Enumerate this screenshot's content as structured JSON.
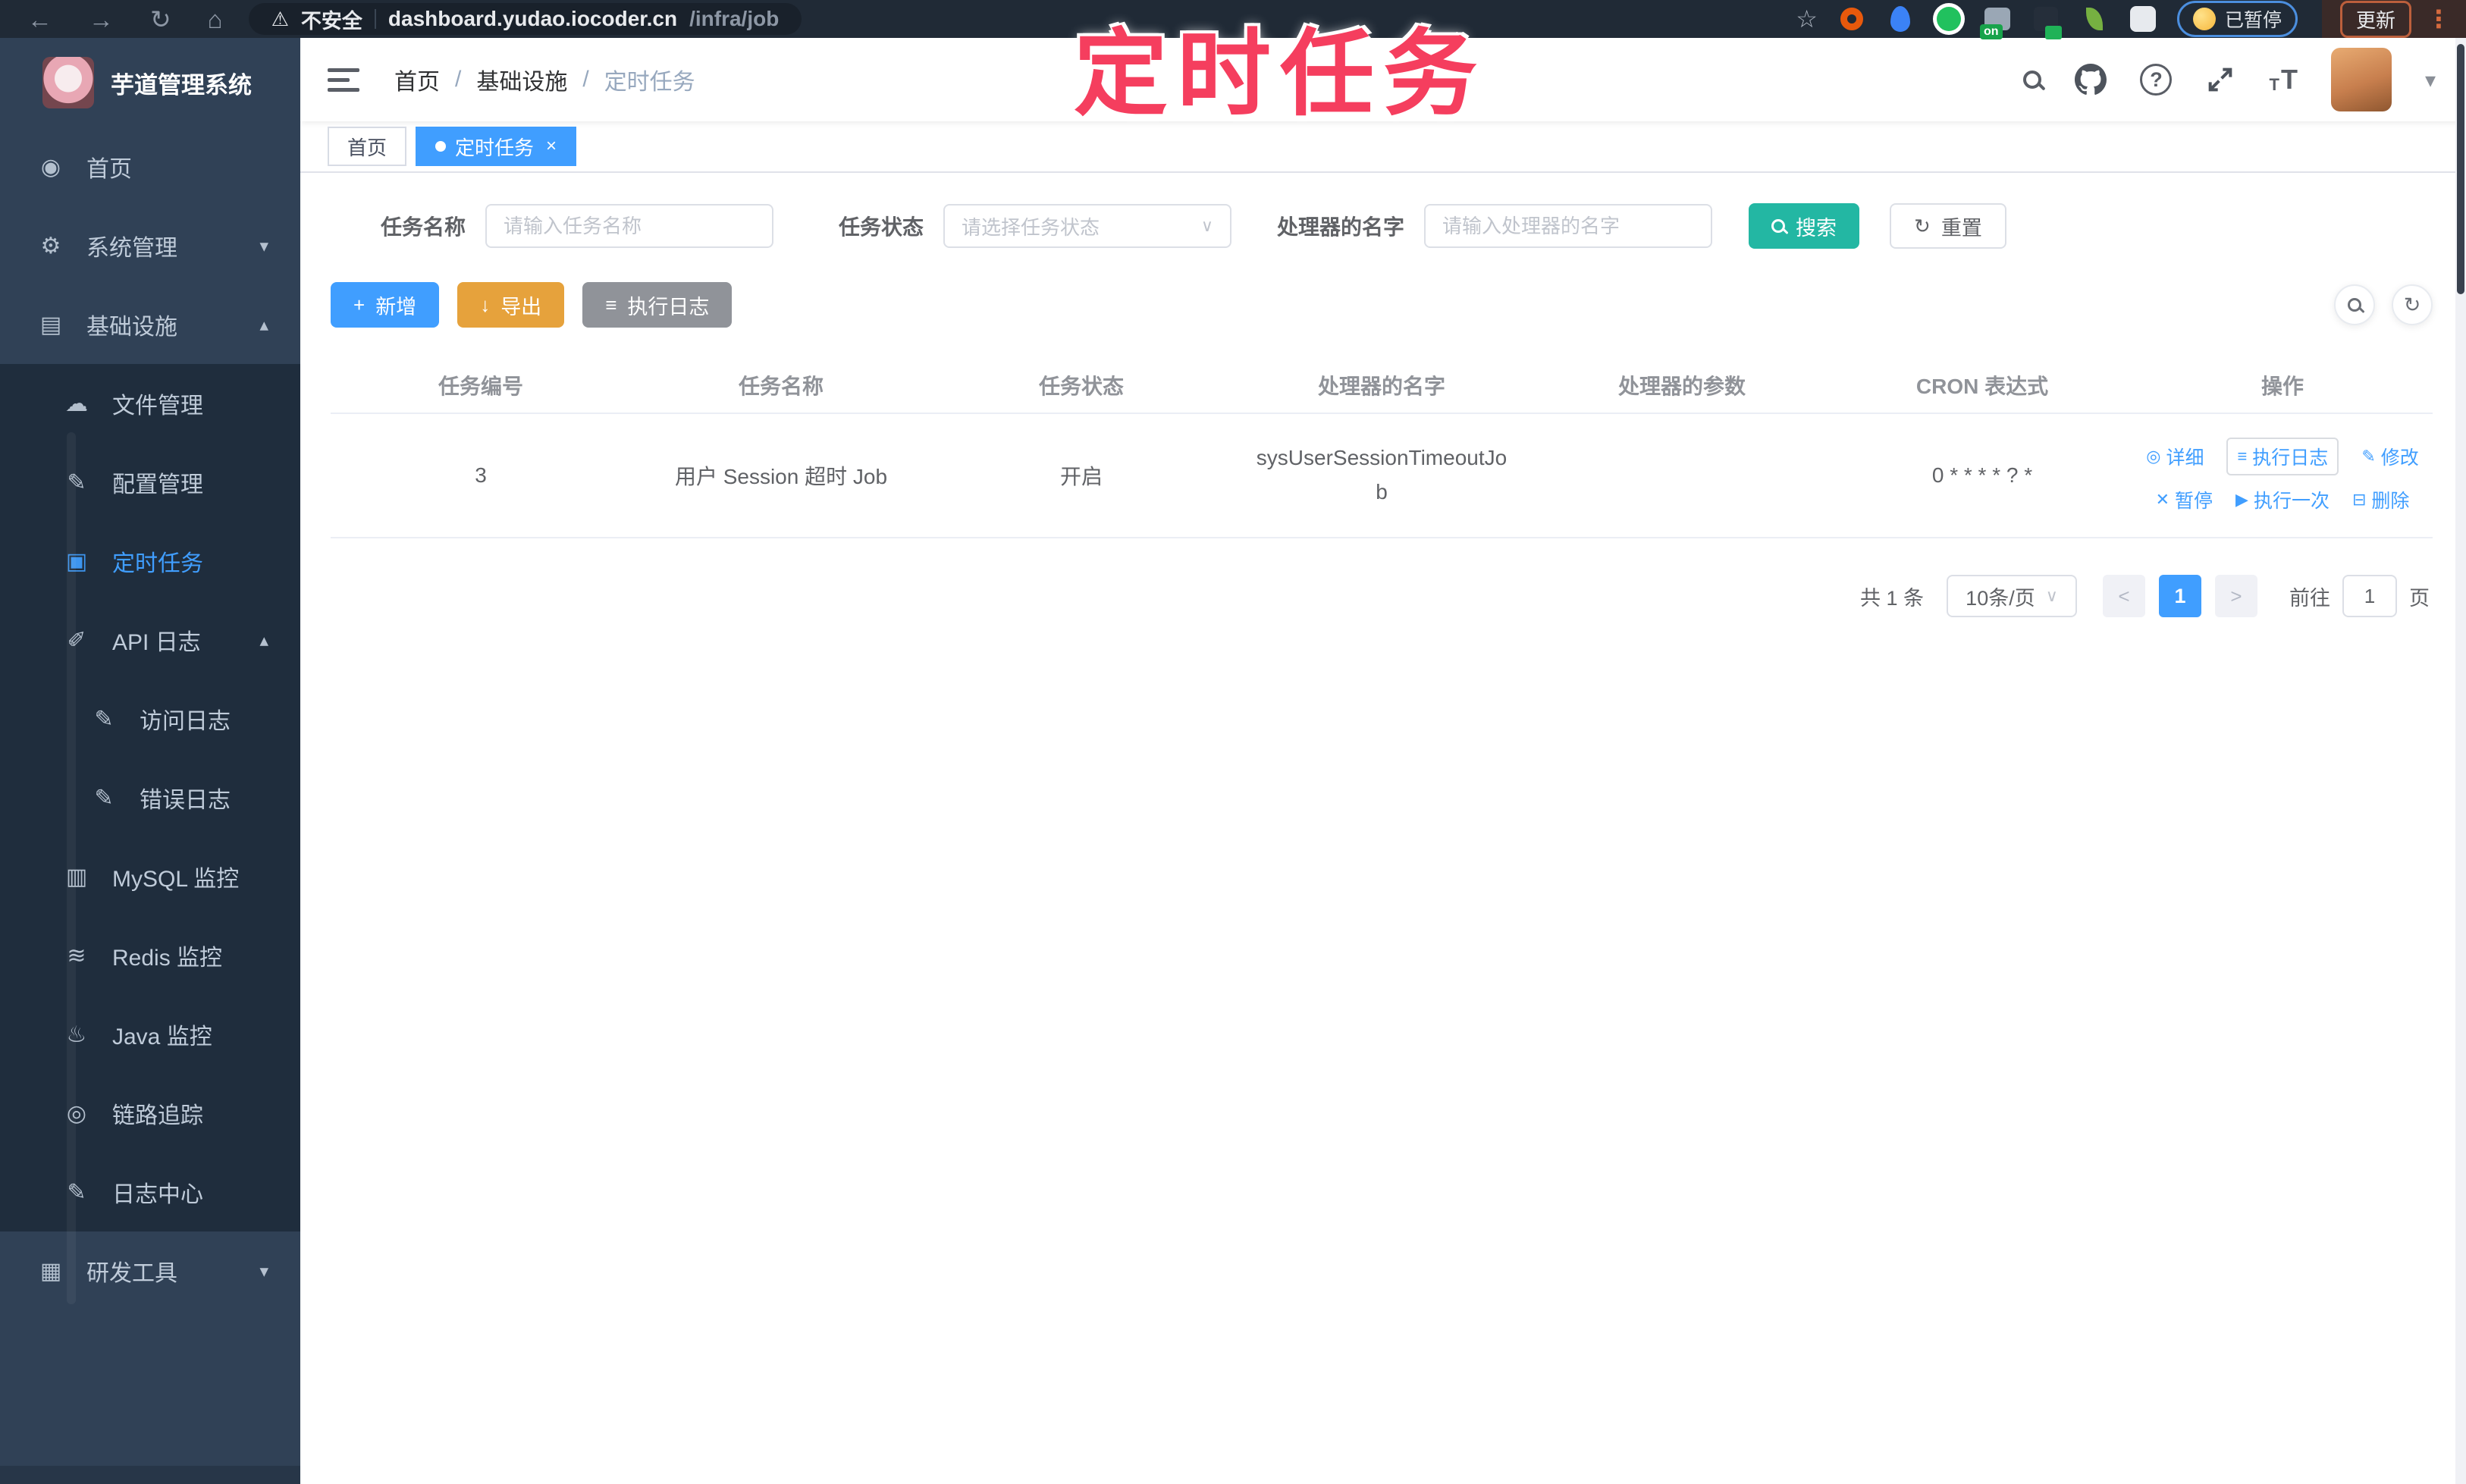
{
  "colors": {
    "primary": "#409EFF",
    "search_button": "#23b7a3",
    "export_button": "#E6A23C",
    "info_button": "#909399",
    "annotation_red": "#f53e5e",
    "sidebar_bg": "#304156",
    "submenu_bg": "#1f2d3d",
    "sidebar_text": "#bfcbd9",
    "browser_bar_bg": "#202a36"
  },
  "browser": {
    "security_label": "不安全",
    "url_host": "dashboard.yudao.iocoder.cn",
    "url_path": "/infra/job",
    "ext_badge": "on",
    "paused_label": "已暂停",
    "update_label": "更新"
  },
  "icons": {
    "back": "←",
    "forward": "→",
    "reload": "↻",
    "home": "⌂",
    "warning": "⚠",
    "star": "☆",
    "question": "?",
    "caret_down": "▾",
    "dots": "⋮",
    "t_big": "T",
    "t_small": "T",
    "select_caret": "∨",
    "refresh": "↻",
    "close": "×",
    "prev": "<",
    "next": ">",
    "download": "↓",
    "plus": "+",
    "list": "≡"
  },
  "sidebar": {
    "title": "芋道管理系统",
    "items": [
      {
        "label": "首页",
        "icon": "◉"
      },
      {
        "label": "系统管理",
        "icon": "⚙",
        "arrow": "▾"
      },
      {
        "label": "基础设施",
        "icon": "▤",
        "arrow": "▴"
      },
      {
        "label": "文件管理",
        "icon": "☁"
      },
      {
        "label": "配置管理",
        "icon": "✎"
      },
      {
        "label": "定时任务",
        "icon": "▣"
      },
      {
        "label": "API 日志",
        "icon": "✐",
        "arrow": "▴"
      },
      {
        "label": "访问日志",
        "icon": "✎"
      },
      {
        "label": "错误日志",
        "icon": "✎"
      },
      {
        "label": "MySQL 监控",
        "icon": "▥"
      },
      {
        "label": "Redis 监控",
        "icon": "≋"
      },
      {
        "label": "Java 监控",
        "icon": "♨"
      },
      {
        "label": "链路追踪",
        "icon": "◎"
      },
      {
        "label": "日志中心",
        "icon": "✎"
      },
      {
        "label": "研发工具",
        "icon": "▦",
        "arrow": "▾"
      }
    ]
  },
  "header": {
    "breadcrumb": [
      "首页",
      "基础设施",
      "定时任务"
    ],
    "separator": "/"
  },
  "annotation": "定时任务",
  "tabs": [
    {
      "label": "首页"
    },
    {
      "label": "定时任务"
    }
  ],
  "filters": {
    "name_label": "任务名称",
    "name_placeholder": "请输入任务名称",
    "status_label": "任务状态",
    "status_placeholder": "请选择任务状态",
    "handler_label": "处理器的名字",
    "handler_placeholder": "请输入处理器的名字",
    "search_label": "搜索",
    "reset_label": "重置"
  },
  "toolbar": {
    "add": "新增",
    "export": "导出",
    "exec_log": "执行日志"
  },
  "table": {
    "headers": [
      "任务编号",
      "任务名称",
      "任务状态",
      "处理器的名字",
      "处理器的参数",
      "CRON 表达式",
      "操作"
    ],
    "row": {
      "id": "3",
      "name": "用户 Session 超时 Job",
      "status": "开启",
      "handler": "sysUserSessionTimeoutJob",
      "params": "",
      "cron": "0 * * * * ? *"
    },
    "actions": [
      {
        "icon": "◎",
        "label": "详细"
      },
      {
        "icon": "≡",
        "label": "执行日志"
      },
      {
        "icon": "✎",
        "label": "修改"
      },
      {
        "icon": "✕",
        "label": "暂停"
      },
      {
        "icon": "▶",
        "label": "执行一次"
      },
      {
        "icon": "⊟",
        "label": "删除"
      }
    ]
  },
  "pagination": {
    "total": "共 1 条",
    "page_size": "10条/页",
    "current": "1",
    "goto_label": "前往",
    "page_unit": "页",
    "goto_value": "1"
  }
}
